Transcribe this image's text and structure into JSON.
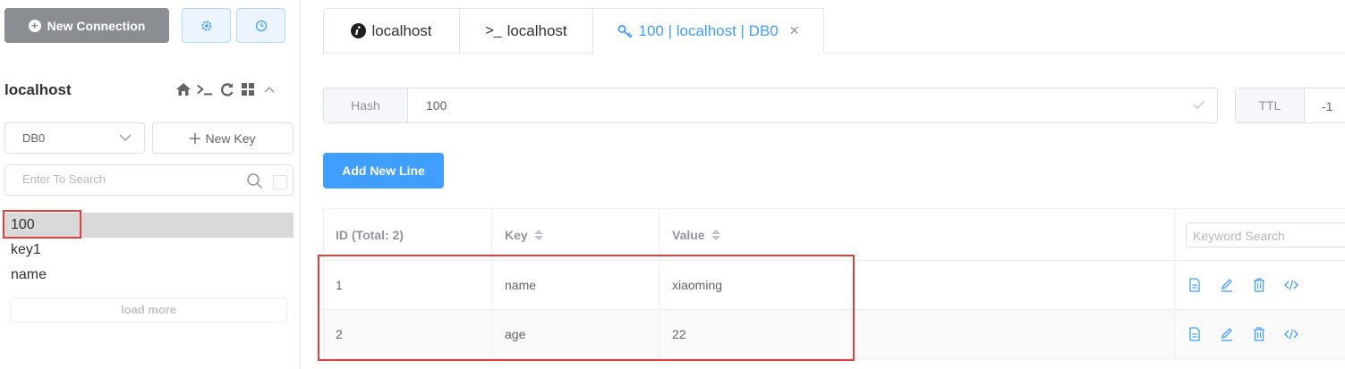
{
  "sidebar": {
    "new_connection_label": "New Connection",
    "connection_name": "localhost",
    "db_select_value": "DB0",
    "new_key_label": "New Key",
    "search_placeholder": "Enter To Search",
    "keys": [
      "100",
      "key1",
      "name"
    ],
    "active_key": "100",
    "load_more_label": "load more"
  },
  "tabs": [
    {
      "label": "localhost",
      "icon": "info-icon"
    },
    {
      "label": "localhost",
      "icon": "terminal-icon"
    },
    {
      "label": "100 | localhost | DB0",
      "icon": "key-icon"
    }
  ],
  "key_view": {
    "type_label": "Hash",
    "key_name": "100",
    "ttl_label": "TTL",
    "ttl_value": "-1",
    "add_line_label": "Add New Line"
  },
  "table": {
    "headers": {
      "id": "ID (Total: 2)",
      "key": "Key",
      "value": "Value"
    },
    "keyword_placeholder": "Keyword Search",
    "rows": [
      {
        "id": "1",
        "key": "name",
        "value": "xiaoming"
      },
      {
        "id": "2",
        "key": "age",
        "value": "22"
      }
    ]
  },
  "colors": {
    "accent": "#409eff",
    "highlight": "#e53e3e",
    "sidebar_button": "#8a8d92"
  }
}
